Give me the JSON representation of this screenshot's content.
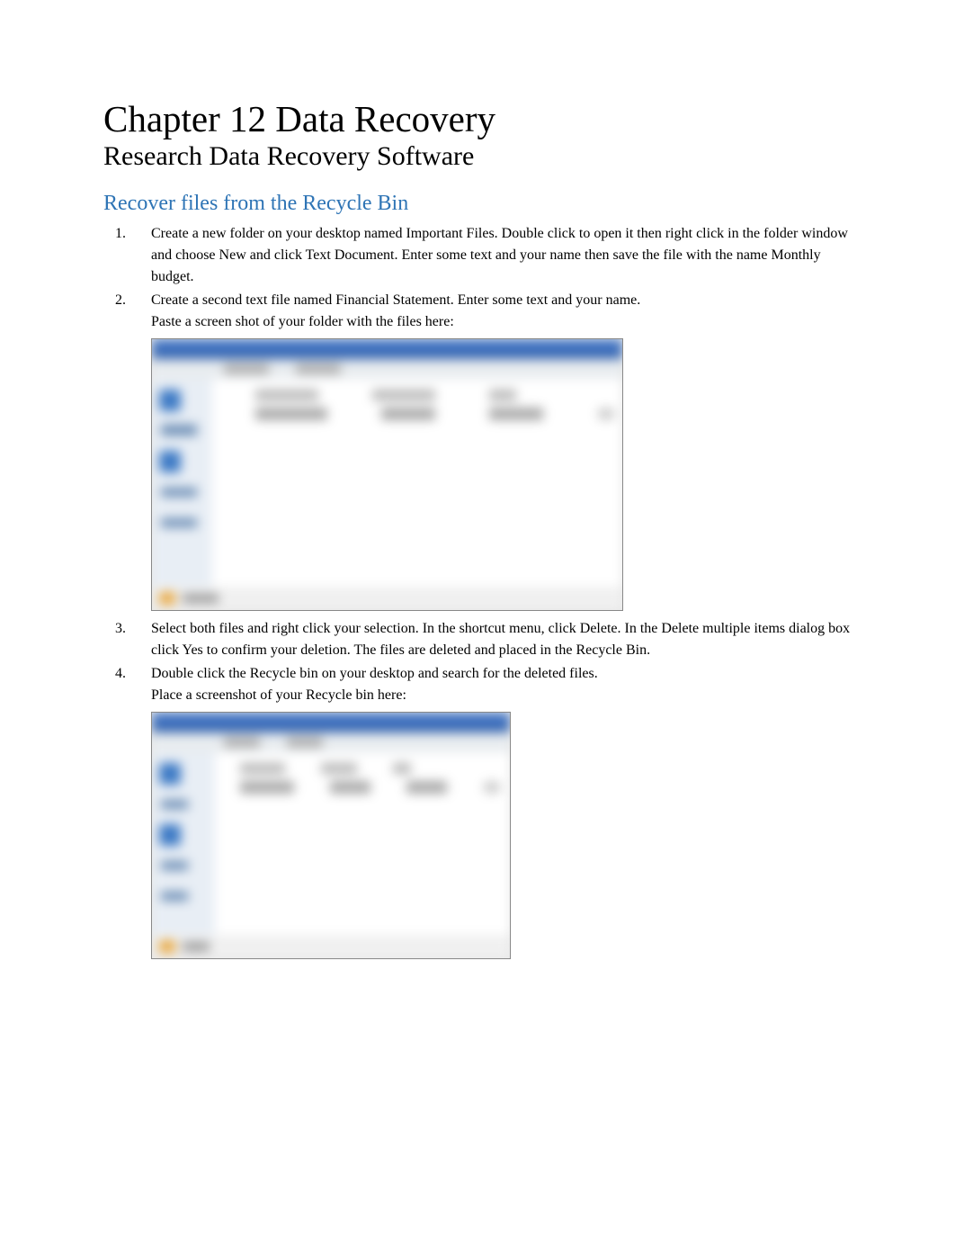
{
  "title": "Chapter 12 Data Recovery",
  "subtitle": "Research Data Recovery Software",
  "section_heading": "Recover files from the Recycle Bin",
  "items": [
    {
      "num": "1.",
      "text": "Create a new folder on your desktop named Important Files. Double click to open it then right click in the folder window and choose New and click Text Document. Enter some text and your name then save the file with the name Monthly budget."
    },
    {
      "num": "2.",
      "text": "Create a second text file named Financial Statement. Enter some text and your name.",
      "after_text": "Paste a screen shot of your folder with the files here:"
    },
    {
      "num": "3.",
      "text": "Select both files and right click your selection. In the shortcut menu, click Delete. In the Delete multiple items dialog box click Yes to confirm your deletion. The files are deleted and placed in the Recycle Bin."
    },
    {
      "num": "4.",
      "text": "Double click the Recycle bin on your desktop and search for the deleted files.",
      "after_text": "Place a screenshot of your Recycle bin here:"
    }
  ]
}
